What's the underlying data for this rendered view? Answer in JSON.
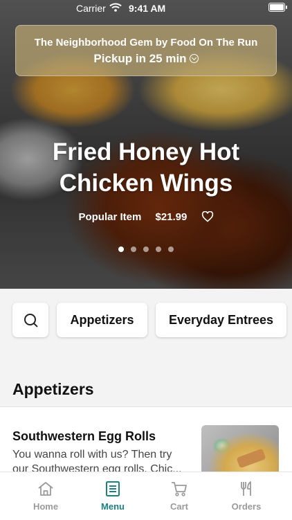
{
  "status_bar": {
    "carrier": "Carrier",
    "time": "9:41 AM"
  },
  "hero": {
    "pickup_title": "The Neighborhood Gem by Food On The Run",
    "pickup_time": "Pickup in 25 min",
    "item_title": "Fried Honey Hot Chicken Wings",
    "tag": "Popular Item",
    "price": "$21.99",
    "carousel_count": 5,
    "carousel_active": 1
  },
  "categories": {
    "search_icon": "search-icon",
    "items": [
      "Appetizers",
      "Everyday Entrees"
    ]
  },
  "section": {
    "title": "Appetizers"
  },
  "menu_item": {
    "name": "Southwestern Egg Rolls",
    "description": "You wanna roll with us? Then try our Southwestern egg rolls. Chic..."
  },
  "tabbar": {
    "items": [
      {
        "label": "Home",
        "icon": "home-icon"
      },
      {
        "label": "Menu",
        "icon": "menu-icon"
      },
      {
        "label": "Cart",
        "icon": "cart-icon"
      },
      {
        "label": "Orders",
        "icon": "utensils-icon"
      }
    ],
    "active": "Menu",
    "active_color": "#1f7f7f",
    "inactive_color": "#9a9a9a"
  }
}
